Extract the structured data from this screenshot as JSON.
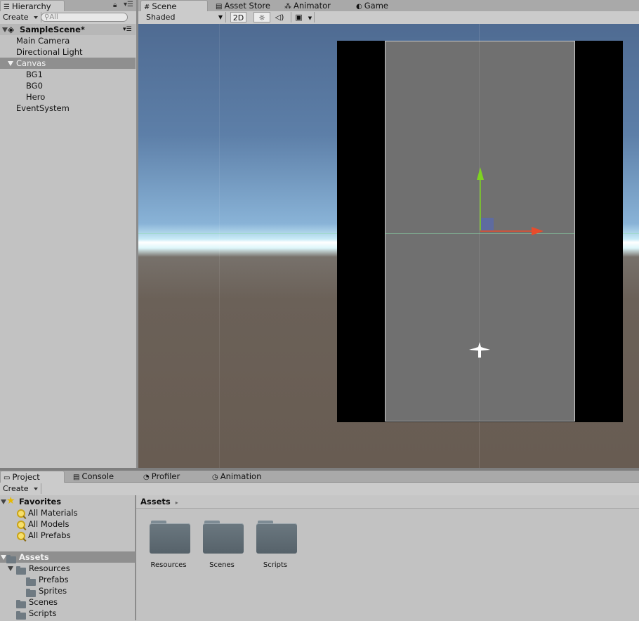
{
  "hierarchy": {
    "tab_label": "Hierarchy",
    "create_label": "Create",
    "search_placeholder": "All",
    "scene_name": "SampleScene*",
    "items": [
      {
        "label": "Main Camera"
      },
      {
        "label": "Directional Light"
      },
      {
        "label": "Canvas"
      },
      {
        "label": "BG1"
      },
      {
        "label": "BG0"
      },
      {
        "label": "Hero"
      },
      {
        "label": "EventSystem"
      }
    ],
    "selected": "Canvas"
  },
  "scene_tabs": [
    {
      "label": "Scene",
      "icon": "grid-icon"
    },
    {
      "label": "Asset Store",
      "icon": "store-icon"
    },
    {
      "label": "Animator",
      "icon": "animator-icon"
    },
    {
      "label": "Game",
      "icon": "game-icon"
    }
  ],
  "scene_toolbar": {
    "shading_mode": "Shaded",
    "mode_2d": "2D"
  },
  "bottom_tabs": [
    {
      "label": "Project",
      "icon": "folder-icon"
    },
    {
      "label": "Console",
      "icon": "console-icon"
    },
    {
      "label": "Profiler",
      "icon": "profiler-icon"
    },
    {
      "label": "Animation",
      "icon": "clock-icon"
    }
  ],
  "project": {
    "create_label": "Create",
    "favorites_label": "Favorites",
    "favorites": [
      {
        "label": "All Materials"
      },
      {
        "label": "All Models"
      },
      {
        "label": "All Prefabs"
      }
    ],
    "assets_label": "Assets",
    "tree": [
      {
        "label": "Resources"
      },
      {
        "label": "Prefabs"
      },
      {
        "label": "Sprites"
      },
      {
        "label": "Scenes"
      },
      {
        "label": "Scripts"
      }
    ],
    "breadcrumb": "Assets",
    "grid_folders": [
      {
        "label": "Resources"
      },
      {
        "label": "Scenes"
      },
      {
        "label": "Scripts"
      }
    ]
  },
  "colors": {
    "panel_bg": "#c2c2c2",
    "selection": "#8f8f8f",
    "canvas_bg": "#707070",
    "gizmo_y": "#7ed321",
    "gizmo_x": "#e84c2c"
  }
}
